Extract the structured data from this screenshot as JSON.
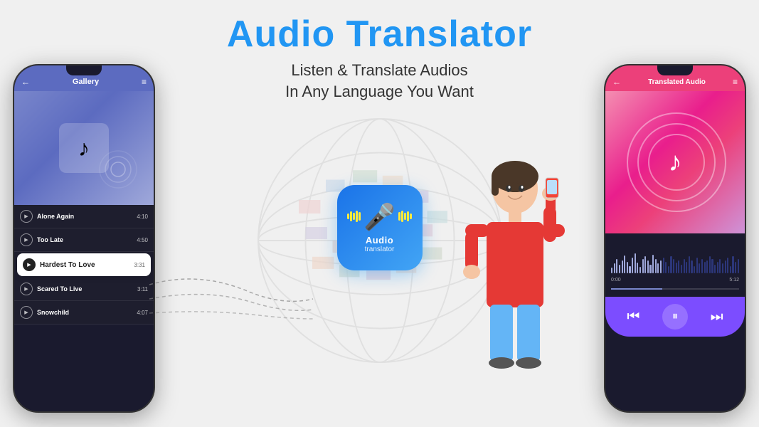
{
  "title": "Audio Translator",
  "subtitle_line1": "Listen & Translate Audios",
  "subtitle_line2": "In Any Language You Want",
  "app_icon": {
    "label": "Audio",
    "sublabel": "translator"
  },
  "left_phone": {
    "header_title": "Gallery",
    "songs": [
      {
        "name": "Alone Again",
        "duration": "4:10",
        "active": false
      },
      {
        "name": "Too Late",
        "duration": "4:50",
        "active": false
      },
      {
        "name": "Hardest To Love",
        "duration": "3:31",
        "active": true
      },
      {
        "name": "Scared To Live",
        "duration": "3:11",
        "active": false
      },
      {
        "name": "Snowchild",
        "duration": "4:07",
        "active": false
      }
    ]
  },
  "right_phone": {
    "header_title": "Translated Audio",
    "time_current": "0:00",
    "time_total": "5:12"
  },
  "controls": {
    "prev": "⏮",
    "pause": "⏸",
    "next": "⏭"
  },
  "wave_heights": [
    8,
    14,
    20,
    12,
    18,
    25,
    16,
    10,
    22,
    28,
    15,
    9,
    20,
    24,
    18,
    12,
    26,
    20,
    14,
    18,
    22,
    16,
    10,
    24,
    20,
    15,
    18,
    12,
    20,
    16,
    24,
    18,
    10,
    22,
    14,
    20,
    16,
    18,
    24,
    20,
    12,
    16,
    20,
    14,
    18,
    22,
    10,
    24,
    16,
    20
  ]
}
